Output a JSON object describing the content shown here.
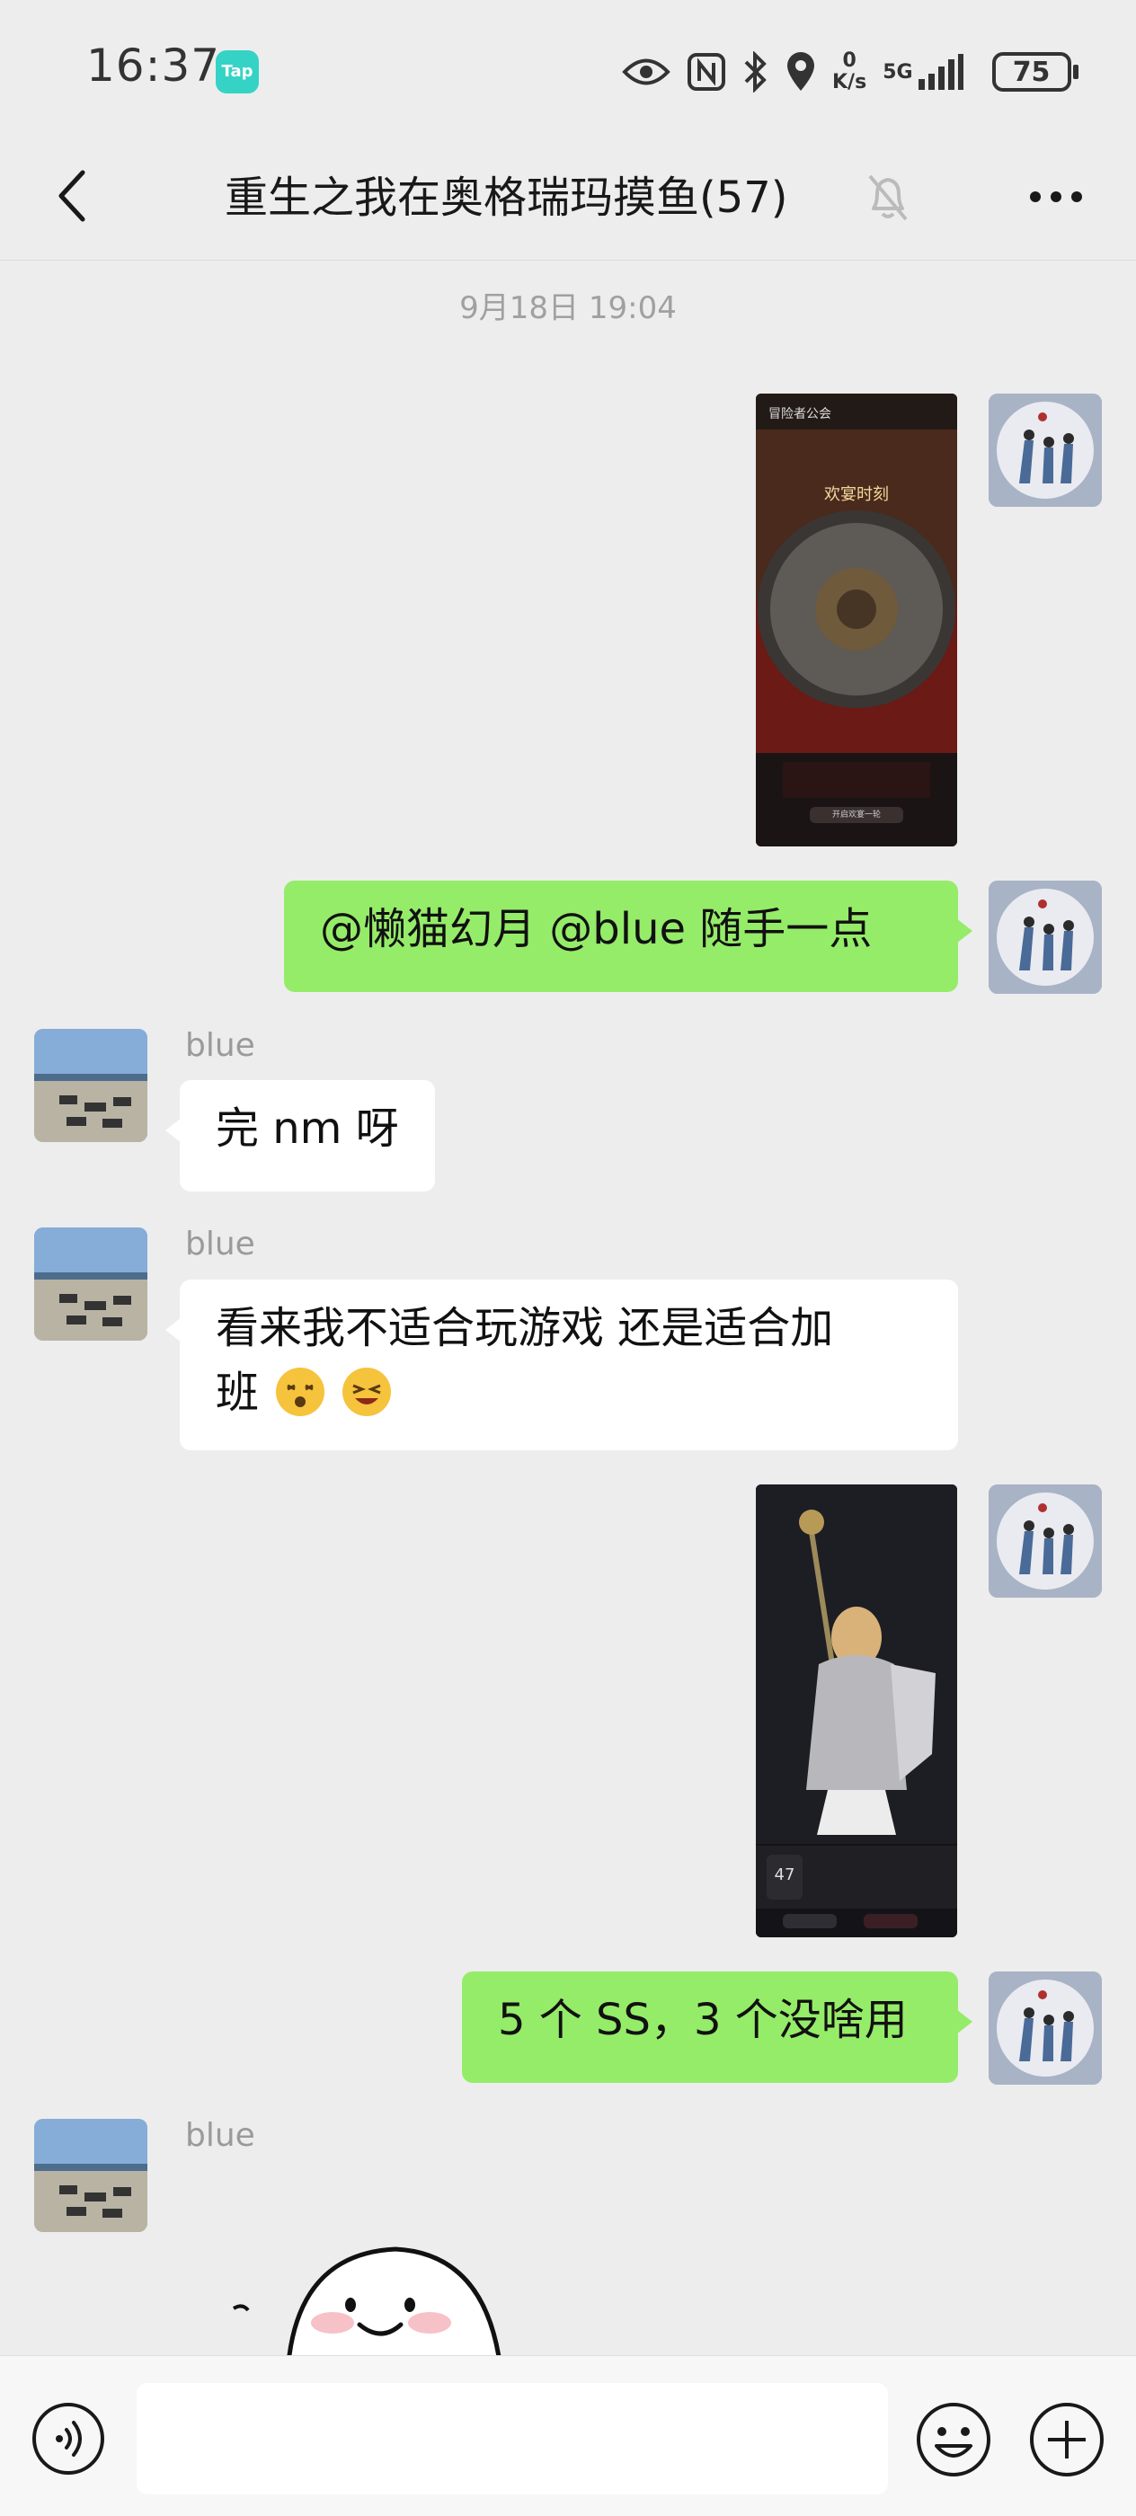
{
  "status_bar": {
    "time": "16:37",
    "tap_badge": "Tap",
    "net_speed_value": "0",
    "net_speed_unit": "K/s",
    "network": "5G",
    "battery": "75",
    "icons": [
      "eye-icon",
      "nfc-icon",
      "bluetooth-icon",
      "location-icon",
      "signal-icon",
      "battery-icon"
    ]
  },
  "header": {
    "title": "重生之我在奥格瑞玛摸鱼(57)",
    "icons": [
      "back-icon",
      "mute-bell-icon",
      "more-icon"
    ]
  },
  "chat": {
    "timestamp": "9月18日 19:04",
    "messages": [
      {
        "sender": "",
        "type": "image",
        "image": {
          "top_label": "冒险者公会",
          "banner": "欢宴时刻",
          "button": "开启欢宴一轮"
        }
      },
      {
        "sender": "",
        "type": "text",
        "text": "@懒猫幻月 @blue 随手一点"
      },
      {
        "sender": "blue",
        "type": "text",
        "text": "完 nm 呀"
      },
      {
        "sender": "blue",
        "type": "text",
        "text_line1": "看来我不适合玩游戏 还是适合加",
        "text_line2": "班"
      },
      {
        "sender": "",
        "type": "image",
        "image": {
          "level": "47"
        }
      },
      {
        "sender": "",
        "type": "text",
        "text": "5 个 SS，3 个没啥用"
      },
      {
        "sender": "blue",
        "type": "sticker"
      }
    ]
  },
  "input_bar": {
    "placeholder": "",
    "icons": [
      "voice-icon",
      "emoji-icon",
      "plus-icon"
    ]
  },
  "colors": {
    "background": "#ededed",
    "bubble_self": "#95ec69",
    "bubble_other": "#ffffff",
    "sender_name": "#9a9a9a"
  }
}
